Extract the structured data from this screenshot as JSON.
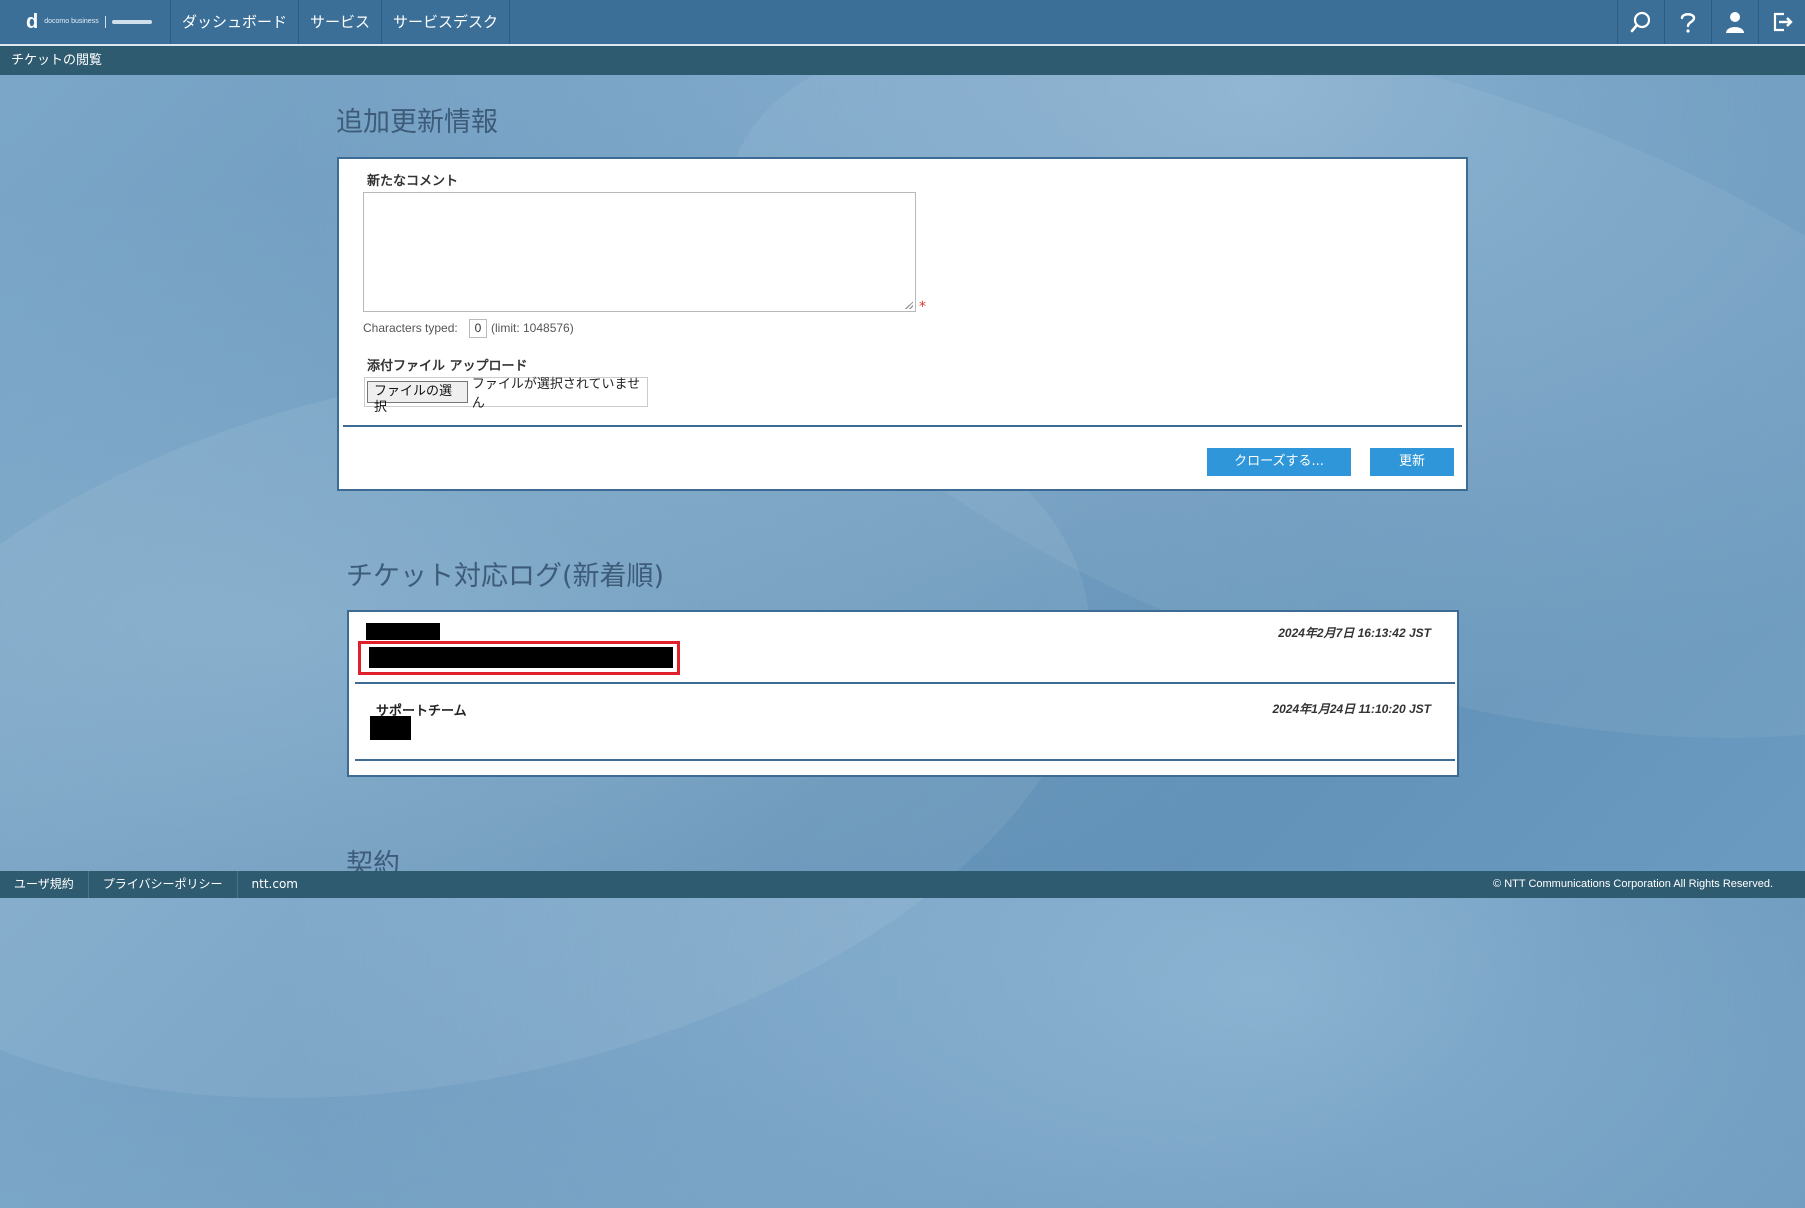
{
  "header": {
    "logo_main": "d",
    "logo_sub": "docomo business",
    "nav": [
      "ダッシュボード",
      "サービス",
      "サービスデスク"
    ],
    "icons": [
      "search-icon",
      "help-icon",
      "user-icon",
      "logout-icon"
    ]
  },
  "breadcrumb": "チケットの閲覧",
  "update_section": {
    "title": "追加更新情報",
    "comment_label": "新たなコメント",
    "required_mark": "*",
    "chars_label": "Characters typed:",
    "chars_value": "0",
    "chars_limit": "(limit: 1048576)",
    "attach_label": "添付ファイル アップロード",
    "file_button": "ファイルの選択",
    "file_status": "ファイルが選択されていません",
    "close_button": "クローズする...",
    "update_button": "更新"
  },
  "log_section": {
    "title": "チケット対応ログ(新着順)",
    "entries": [
      {
        "author": "",
        "timestamp": "2024年2月7日 16:13:42 JST"
      },
      {
        "author": "サポートチーム",
        "timestamp": "2024年1月24日 11:10:20 JST"
      }
    ]
  },
  "contract_section": {
    "title": "契約"
  },
  "footer": {
    "links": [
      "ユーザ規約",
      "プライバシーポリシー",
      "ntt.com"
    ],
    "copyright": "© NTT Communications Corporation All Rights Reserved."
  },
  "colors": {
    "topbar": "#3b6f98",
    "subbar": "#2f5b71",
    "button": "#2f97d9",
    "highlight": "#e0202a"
  }
}
